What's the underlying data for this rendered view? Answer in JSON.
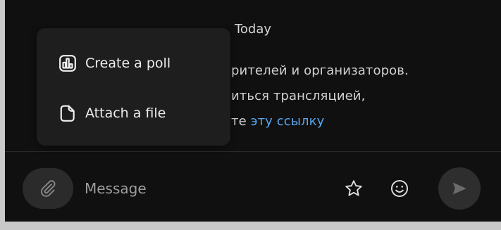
{
  "chat": {
    "date_separator": "Today",
    "message": {
      "line1": "рителей и организаторов.",
      "line2": "иться трансляцией,",
      "line3_text": "те ",
      "line3_link": "эту ссылку"
    }
  },
  "popup_menu": {
    "items": [
      {
        "label": "Create a poll",
        "icon": "poll-icon"
      },
      {
        "label": "Attach a file",
        "icon": "file-icon"
      }
    ]
  },
  "composer": {
    "placeholder": "Message",
    "attach_icon": "paperclip-icon",
    "favorite_icon": "star-icon",
    "emoji_icon": "emoji-icon",
    "send_icon": "send-icon"
  },
  "colors": {
    "background": "#101010",
    "popup": "#1e1e1e",
    "link": "#5aa7f0",
    "text": "#d0d0d0",
    "button": "#2b2b2b",
    "send_arrow": "#6b6b6b"
  }
}
